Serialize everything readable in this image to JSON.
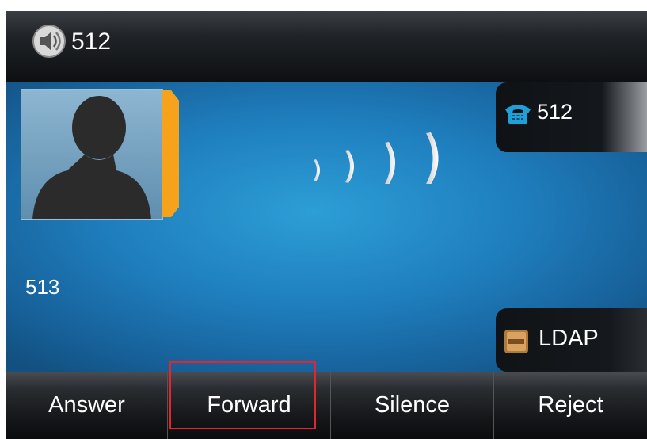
{
  "topbar": {
    "line_label": "512",
    "icon": "speaker-icon"
  },
  "caller": {
    "name": "513",
    "avatar_icon": "contact-silhouette-icon",
    "status_icon": "ringing-waves-icon"
  },
  "side_buttons": [
    {
      "label": "512",
      "icon": "phone-icon"
    },
    {
      "label": "LDAP",
      "icon": "ldap-book-icon"
    }
  ],
  "softkeys": [
    {
      "label": "Answer"
    },
    {
      "label": "Forward"
    },
    {
      "label": "Silence"
    },
    {
      "label": "Reject"
    }
  ],
  "colors": {
    "accent": "#f7a21b",
    "highlight": "#e2262b",
    "screen_blue": "#1f7fbe"
  }
}
